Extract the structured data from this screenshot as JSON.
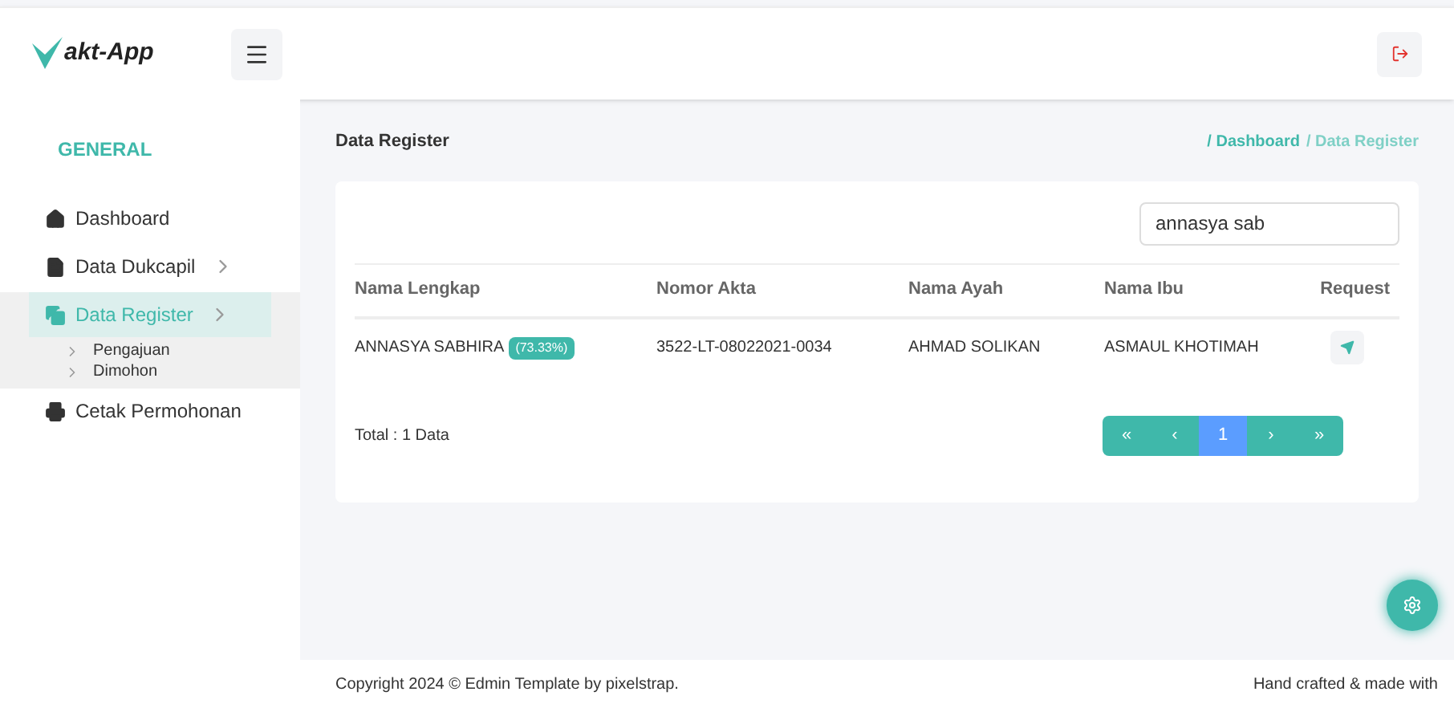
{
  "header": {
    "logo_text": "akt-App"
  },
  "sidebar": {
    "section": "GENERAL",
    "items": [
      {
        "label": "Dashboard",
        "selected": false,
        "has_children": false
      },
      {
        "label": "Data Dukcapil",
        "selected": false,
        "has_children": true
      },
      {
        "label": "Data Register",
        "selected": true,
        "has_children": true,
        "expanded": true,
        "children": [
          {
            "label": "Pengajuan"
          },
          {
            "label": "Dimohon"
          }
        ]
      },
      {
        "label": "Cetak Permohonan",
        "selected": false,
        "has_children": false
      }
    ]
  },
  "page": {
    "title": "Data Register",
    "breadcrumb": [
      {
        "label": "/ Dashboard",
        "current": false
      },
      {
        "label": "/ Data Register",
        "current": true
      }
    ]
  },
  "search": {
    "value": "annasya sab"
  },
  "table": {
    "columns": [
      "Nama Lengkap",
      "Nomor Akta",
      "Nama Ayah",
      "Nama Ibu",
      "Request"
    ],
    "rows": [
      {
        "name": "ANNASYA SABHIRA",
        "match": "(73.33%)",
        "akta": "3522-LT-08022021-0034",
        "ayah": "AHMAD SOLIKAN",
        "ibu": "ASMAUL KHOTIMAH"
      }
    ]
  },
  "total": "Total : 1 Data",
  "pagination": [
    {
      "label": "«",
      "selected": false
    },
    {
      "label": "‹",
      "selected": false
    },
    {
      "label": "1",
      "selected": true
    },
    {
      "label": "›",
      "selected": false
    },
    {
      "label": "»",
      "selected": false
    }
  ],
  "footer": {
    "left": "Copyright 2024 © Edmin Template by pixelstrap.",
    "right": "Hand crafted & made with"
  }
}
